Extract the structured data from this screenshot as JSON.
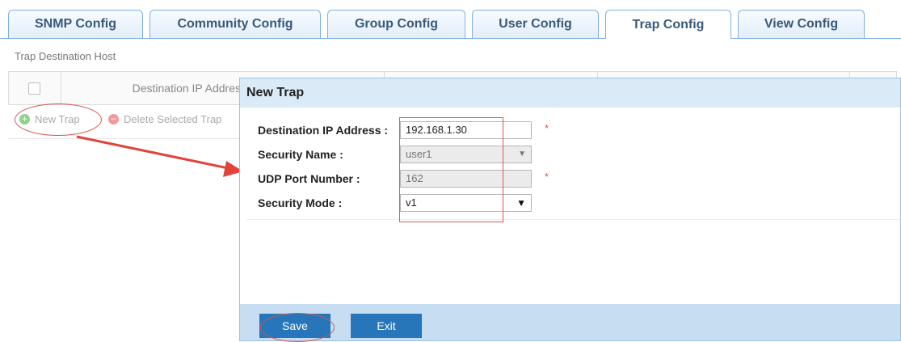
{
  "tabs": [
    {
      "label": "SNMP Config"
    },
    {
      "label": "Community Config"
    },
    {
      "label": "Group Config"
    },
    {
      "label": "User Config"
    },
    {
      "label": "Trap Config"
    },
    {
      "label": "View Config"
    }
  ],
  "active_tab": "Trap Config",
  "section_title": "Trap Destination Host",
  "grid": {
    "column_header": "Destination IP Address"
  },
  "toolbar": {
    "new_trap_label": "New Trap",
    "delete_label": "Delete Selected Trap"
  },
  "modal": {
    "title": "New Trap",
    "fields": {
      "destination_ip": {
        "label": "Destination IP Address :",
        "value": "192.168.1.30",
        "required_mark": "*"
      },
      "security_name": {
        "label": "Security Name :",
        "value": "user1"
      },
      "udp_port": {
        "label": "UDP Port Number :",
        "value": "162",
        "required_mark": "*"
      },
      "security_mode": {
        "label": "Security Mode :",
        "value": "v1"
      }
    },
    "save_label": "Save",
    "exit_label": "Exit"
  },
  "colors": {
    "accent": "#2776ba",
    "annotation_red": "#e0443a",
    "modal_header": "#dbeaf7",
    "footer": "#c7ddf2"
  },
  "icons": [
    "plus-circle-icon",
    "minus-circle-icon",
    "chevron-down-icon"
  ]
}
